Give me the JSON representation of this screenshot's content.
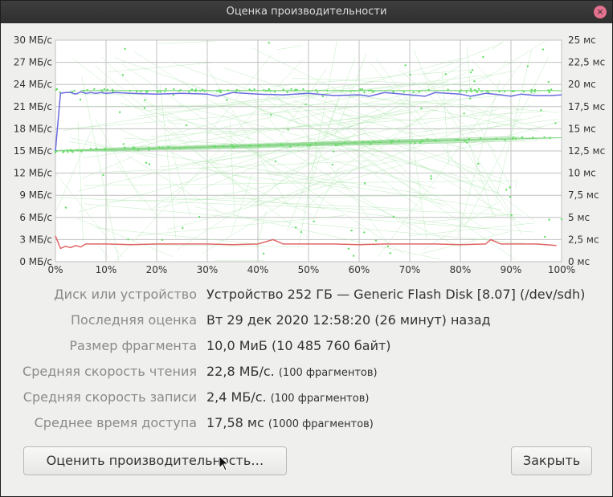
{
  "window": {
    "title": "Оценка производительности",
    "close_glyph": "×"
  },
  "chart": {
    "left_axis_ticks": [
      "30 МБ/с",
      "27 МБ/с",
      "24 МБ/с",
      "21 МБ/с",
      "18 МБ/с",
      "15 МБ/с",
      "12 МБ/с",
      "9 МБ/с",
      "6 МБ/с",
      "3 МБ/с",
      "0 МБ/с"
    ],
    "right_axis_ticks": [
      "25 мс",
      "22,5 мс",
      "20 мс",
      "17,5 мс",
      "15 мс",
      "12,5 мс",
      "10 мс",
      "7,5 мс",
      "5 мс",
      "2,5 мс",
      "0 мс"
    ],
    "x_axis_ticks": [
      "0%",
      "10%",
      "20%",
      "30%",
      "40%",
      "50%",
      "60%",
      "70%",
      "80%",
      "90%",
      "100%"
    ],
    "colors": {
      "read_line": "#6a6ae0",
      "write_line": "#e06666",
      "access_points": "#66dd66",
      "grid": "#c0c0c0"
    }
  },
  "chart_data": {
    "type": "line",
    "x_range": [
      0,
      100
    ],
    "y_left_range": [
      0,
      30
    ],
    "y_right_range": [
      0,
      25
    ],
    "grid": true,
    "series": [
      {
        "kind": "read",
        "axis": "left",
        "x": [
          0,
          1,
          2,
          3,
          4,
          5,
          6,
          7,
          8,
          9,
          10,
          12,
          15,
          20,
          25,
          30,
          32,
          35,
          40,
          45,
          50,
          55,
          60,
          62,
          65,
          70,
          73,
          75,
          80,
          82,
          85,
          88,
          90,
          92,
          95,
          98,
          100
        ],
        "values": [
          15.0,
          22.8,
          22.9,
          22.9,
          22.7,
          23.0,
          22.8,
          22.9,
          22.8,
          22.9,
          22.8,
          22.9,
          22.8,
          22.7,
          22.8,
          22.7,
          22.4,
          22.9,
          22.7,
          22.6,
          22.8,
          22.5,
          22.6,
          22.4,
          22.9,
          22.6,
          22.4,
          22.9,
          22.7,
          22.4,
          22.8,
          22.6,
          22.4,
          22.7,
          22.5,
          22.5,
          22.6
        ]
      },
      {
        "kind": "write",
        "axis": "left",
        "x": [
          0,
          1,
          2,
          3,
          4,
          5,
          6,
          8,
          10,
          15,
          20,
          25,
          30,
          35,
          40,
          43,
          45,
          50,
          55,
          60,
          65,
          70,
          75,
          80,
          85,
          86,
          88,
          90,
          95,
          99
        ],
        "values": [
          3.5,
          1.8,
          2.1,
          1.9,
          2.2,
          2.0,
          2.4,
          2.4,
          2.4,
          2.3,
          2.4,
          2.4,
          2.4,
          2.3,
          2.4,
          3.0,
          2.4,
          2.4,
          2.4,
          2.3,
          2.4,
          2.4,
          2.4,
          2.3,
          2.4,
          3.0,
          2.4,
          2.4,
          2.4,
          2.2
        ]
      }
    ],
    "access_time_ms_summary": {
      "near_start": 12.5,
      "near_end": 14.0,
      "flat_level": 19.3
    }
  },
  "info": {
    "device_label": "Диск или устройство",
    "device_value": "Устройство 252 ГБ — Generic Flash Disk [8.07] (/dev/sdh)",
    "last_label": "Последняя оценка",
    "last_value": "Вт 29 дек 2020 12:58:20 (26 минут) назад",
    "chunk_label": "Размер фрагмента",
    "chunk_value": "10,0 МиБ (10 485 760 байт)",
    "read_label": "Средняя скорость чтения",
    "read_value": "22,8 МБ/с.",
    "read_count": "(100 фрагментов)",
    "write_label": "Средняя скорость записи",
    "write_value": "2,4 МБ/с.",
    "write_count": "(100 фрагментов)",
    "access_label": "Среднее время доступа",
    "access_value": "17,58 мс",
    "access_count": "(1000 фрагментов)"
  },
  "buttons": {
    "benchmark": "Оценить производительность…",
    "close": "Закрыть"
  },
  "icons": {
    "close": "close-icon",
    "cursor": "mouse-pointer-icon"
  }
}
